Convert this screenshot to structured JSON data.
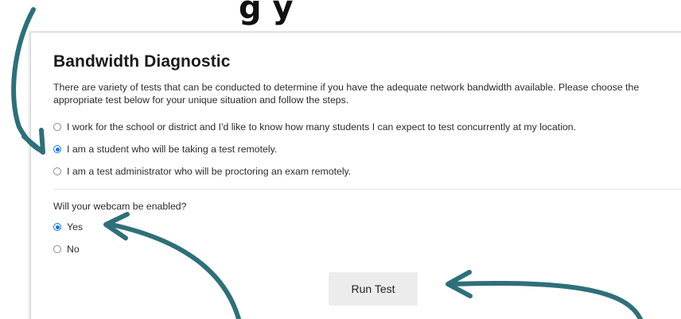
{
  "banner": {
    "partial_heading": "g             y"
  },
  "diagnostic": {
    "title": "Bandwidth Diagnostic",
    "intro": "There are variety of tests that can be conducted to determine if you have the adequate network bandwidth available. Please choose the appropriate test below for your unique situation and follow the steps.",
    "options": [
      {
        "label": "I work for the school or district and I'd like to know how many students I can expect to test concurrently at my location.",
        "selected": false
      },
      {
        "label": "I am a student who will be taking a test remotely.",
        "selected": true
      },
      {
        "label": "I am a test administrator who will be proctoring an exam remotely.",
        "selected": false
      }
    ],
    "webcam_question": "Will your webcam be enabled?",
    "webcam_options": [
      {
        "label": "Yes",
        "selected": true
      },
      {
        "label": "No",
        "selected": false
      }
    ],
    "run_button_label": "Run Test"
  },
  "colors": {
    "radio_selected": "#1a73e8",
    "annotation_arrow": "#2f6f7a"
  }
}
